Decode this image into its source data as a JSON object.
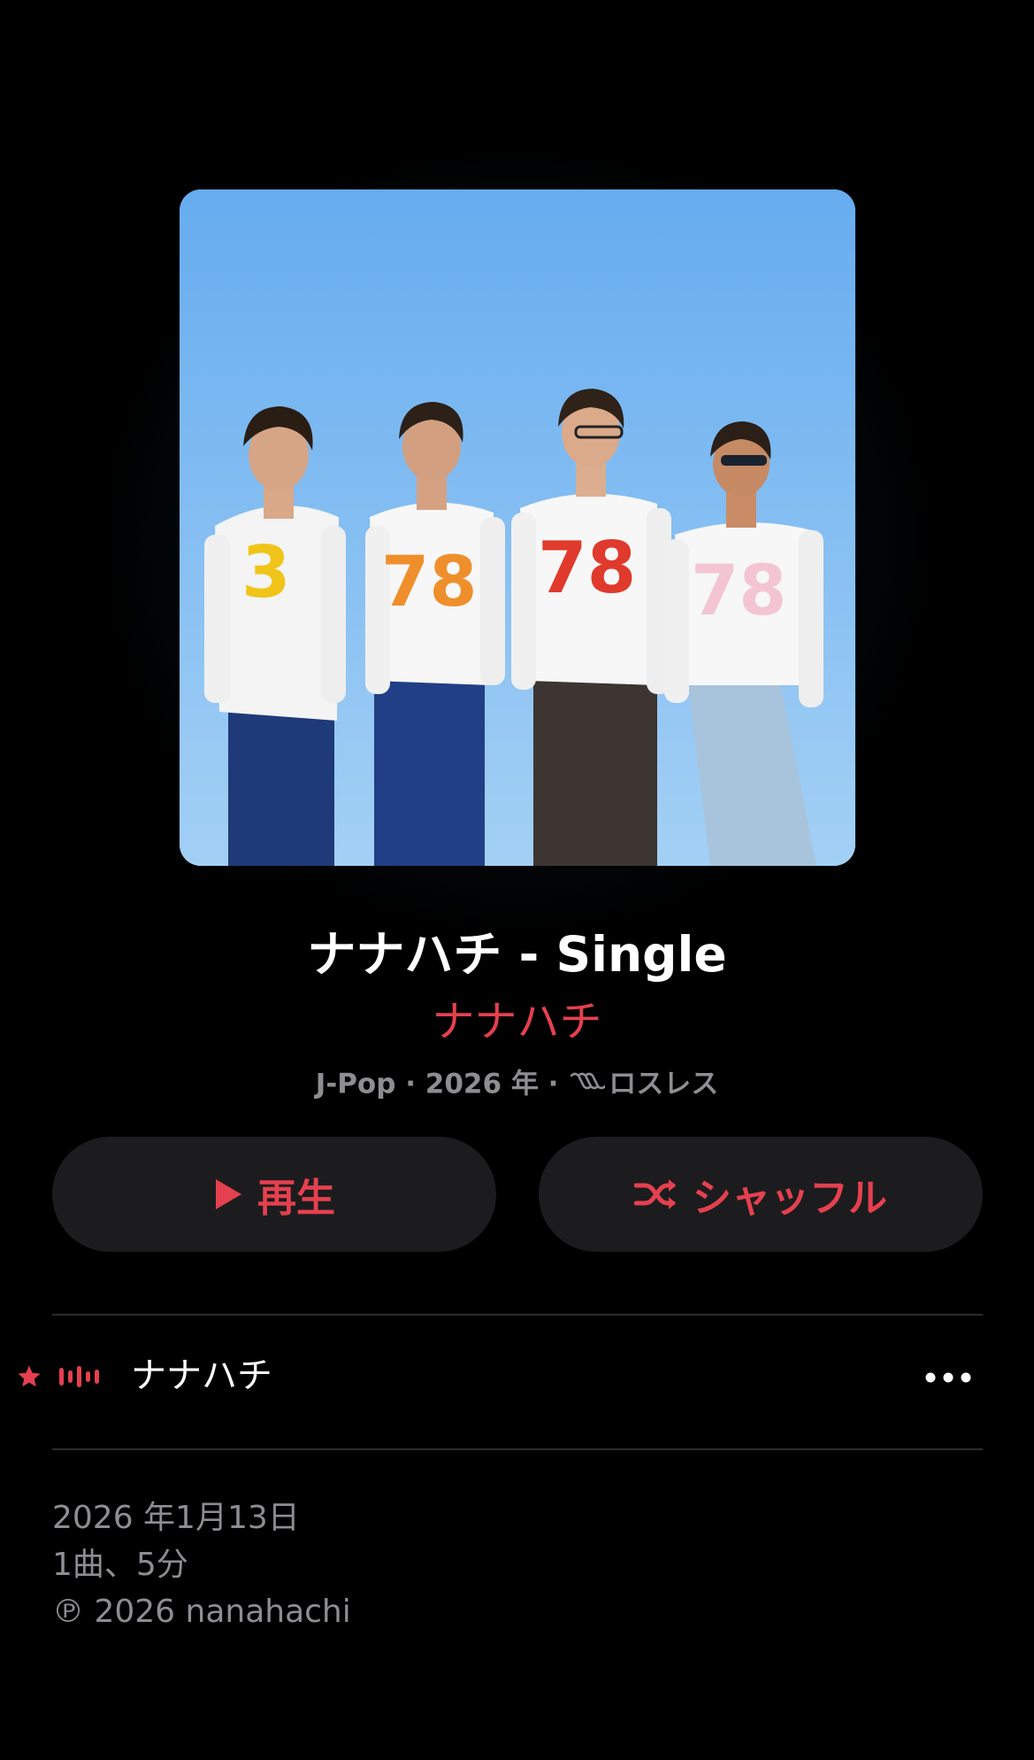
{
  "album": {
    "title": "ナナハチ - Single",
    "artist": "ナナハチ",
    "meta_prefix": "J-Pop · 2026 年 · ",
    "meta_quality": "ロスレス"
  },
  "artwork": {
    "jersey_numbers": [
      "3",
      "78",
      "78",
      "78"
    ]
  },
  "buttons": {
    "play_label": "再生",
    "shuffle_label": "シャッフル"
  },
  "tracks": [
    {
      "title": "ナナハチ",
      "favorite": true,
      "playing": true
    }
  ],
  "footer": {
    "release_date": "2026 年1月13日",
    "summary": "1曲、5分",
    "copyright": "℗ 2026 nanahachi"
  },
  "colors": {
    "accent": "#e5404f",
    "background": "#000000",
    "button_bg": "#1c1c1e",
    "secondary_text": "#8d8d92"
  }
}
